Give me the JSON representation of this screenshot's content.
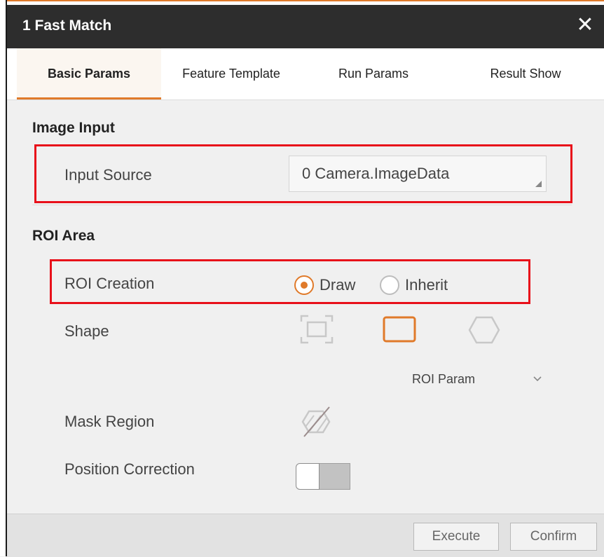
{
  "window": {
    "title": "1 Fast Match",
    "close_icon": "close-icon"
  },
  "tabs": [
    {
      "label": "Basic Params",
      "active": true
    },
    {
      "label": "Feature Template",
      "active": false
    },
    {
      "label": "Run Params",
      "active": false
    },
    {
      "label": "Result Show",
      "active": false
    }
  ],
  "image_input": {
    "section_title": "Image Input",
    "input_source_label": "Input Source",
    "input_source_value": "0 Camera.ImageData"
  },
  "roi_area": {
    "section_title": "ROI Area",
    "roi_creation_label": "ROI Creation",
    "roi_creation_options": [
      {
        "label": "Draw",
        "selected": true
      },
      {
        "label": "Inherit",
        "selected": false
      }
    ],
    "shape_label": "Shape",
    "shapes": [
      {
        "icon": "fullscreen-shape-icon",
        "selected": false
      },
      {
        "icon": "rectangle-shape-icon",
        "selected": true
      },
      {
        "icon": "polygon-shape-icon",
        "selected": false
      }
    ],
    "roi_param_label": "ROI Param",
    "mask_region_label": "Mask Region",
    "mask_icon": "mask-region-icon",
    "position_correction_label": "Position Correction",
    "position_correction_on": false
  },
  "footer": {
    "execute_label": "Execute",
    "confirm_label": "Confirm"
  },
  "colors": {
    "accent": "#e07a2a",
    "highlight_border": "#e8101a",
    "titlebar": "#2d2d2d",
    "panel_bg": "#f0f0f0"
  }
}
